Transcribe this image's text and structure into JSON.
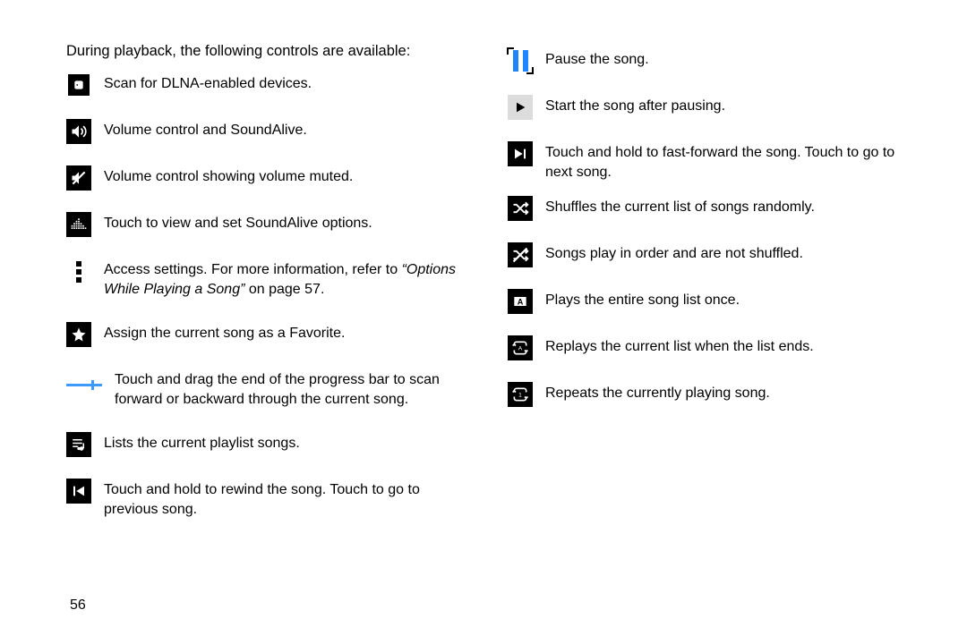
{
  "intro": "During playback, the following controls are available:",
  "page_num": "56",
  "ref_prefix": "Access settings. For more information, refer to ",
  "ref_italic": "“Options While Playing a Song”",
  "ref_suffix": " on page 57.",
  "left": {
    "dlna": "Scan for DLNA-enabled devices.",
    "volume": "Volume control and SoundAlive.",
    "muted": "Volume control showing volume muted.",
    "eq": "Touch to view and set SoundAlive options.",
    "favorite": "Assign the current song as a Favorite.",
    "progress": "Touch and drag the end of the progress bar to scan forward or backward through the current song.",
    "playlist": "Lists the current playlist songs.",
    "rewind": "Touch and hold to rewind the song. Touch to go to previous song."
  },
  "right": {
    "pause": "Pause the song.",
    "play": "Start the song after pausing.",
    "forward": "Touch and hold to fast-forward the song. Touch to go to next song.",
    "shuffle": "Shuffles the current list of songs randomly.",
    "noshuffle": "Songs play in order and are not shuffled.",
    "listonce": "Plays the entire song list once.",
    "replay": "Replays the current list when the list ends.",
    "repeat1": "Repeats the currently playing song."
  }
}
